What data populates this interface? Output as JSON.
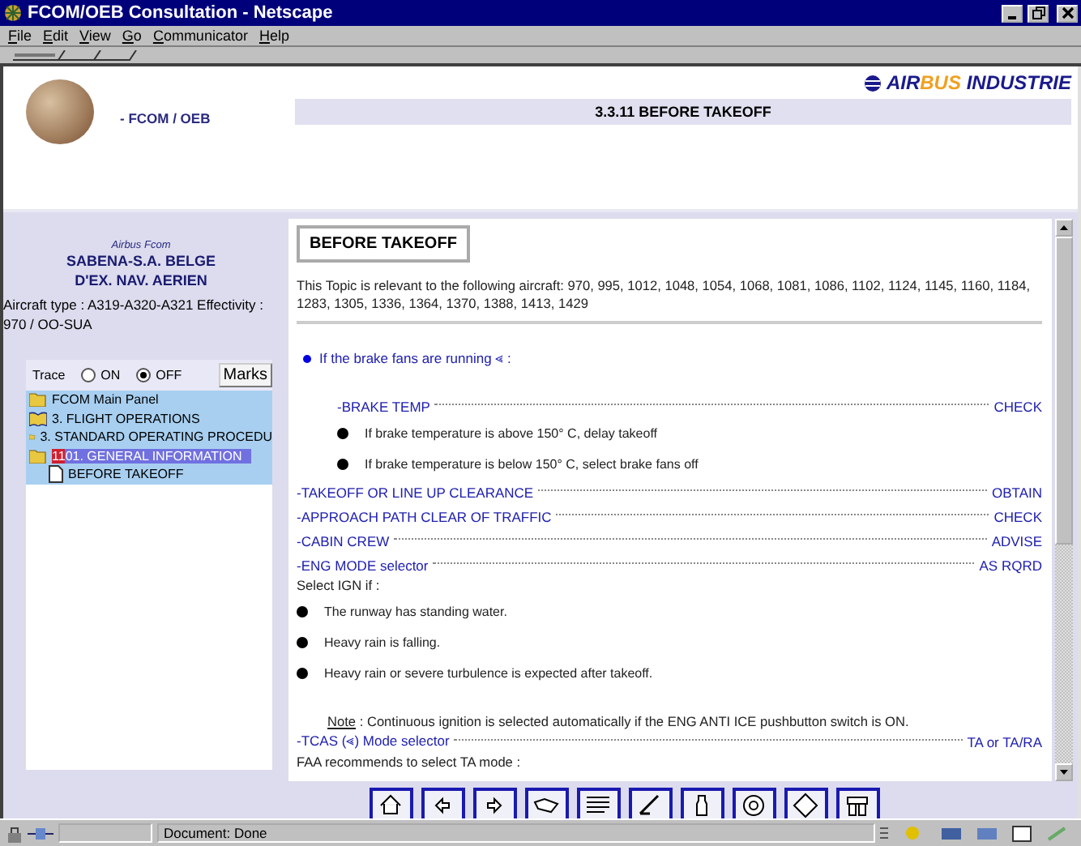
{
  "window": {
    "title": "FCOM/OEB Consultation - Netscape"
  },
  "menu": [
    {
      "label": "File"
    },
    {
      "label": "Edit"
    },
    {
      "label": "View"
    },
    {
      "label": "Go"
    },
    {
      "label": "Communicator"
    },
    {
      "label": "Help"
    }
  ],
  "header": {
    "subtitle": "- FCOM / OEB",
    "brand_parts": [
      {
        "text": "AIR",
        "color": "#1a1a8c"
      },
      {
        "text": "BUS",
        "color": "#f0a020"
      },
      {
        "text": " INDUSTRIE",
        "color": "#1a1a8c"
      }
    ],
    "page_title": "3.3.11 BEFORE TAKEOFF"
  },
  "sidebar": {
    "caption": "Airbus Fcom",
    "operator": [
      "SABENA-S.A. BELGE",
      "D'EX. NAV. AERIEN"
    ],
    "aircraft_info": "Aircraft type : A319-A320-A321 Effectivity : 970 / OO-SUA",
    "trace": {
      "label": "Trace",
      "options": [
        {
          "label": "ON",
          "selected": false
        },
        {
          "label": "OFF",
          "selected": true
        }
      ]
    },
    "marks_button": "Marks",
    "tree": [
      {
        "kind": "folder",
        "label": "FCOM Main Panel",
        "selected": false
      },
      {
        "kind": "book",
        "label": "3. FLIGHT OPERATIONS",
        "selected": false
      },
      {
        "kind": "folder",
        "label": "3. STANDARD OPERATING PROCEDU",
        "selected": false
      },
      {
        "kind": "folder",
        "badge": "11",
        "label": "01. GENERAL INFORMATION",
        "selected": true,
        "children": [
          {
            "kind": "document",
            "label": "BEFORE TAKEOFF",
            "selected": false
          }
        ]
      }
    ]
  },
  "content": {
    "heading": "BEFORE TAKEOFF",
    "relevance": "This Topic is relevant to the following aircraft: 970, 995, 1012, 1048, 1054, 1068, 1081, 1086, 1102, 1124, 1145, 1160, 1184, 1283, 1305, 1336, 1364, 1370, 1388, 1413, 1429",
    "items": [
      {
        "kind": "condition",
        "text": "If the brake fans are running ⪡ :"
      },
      {
        "kind": "check",
        "indented": true,
        "label": "-BRAKE TEMP",
        "action": "CHECK"
      },
      {
        "kind": "bullet",
        "indented": true,
        "text": "If brake temperature is above 150° C, delay takeoff"
      },
      {
        "kind": "bullet",
        "indented": true,
        "text": "If brake temperature is below 150° C, select brake fans off"
      },
      {
        "kind": "check",
        "indented": false,
        "label": "-TAKEOFF OR LINE UP CLEARANCE",
        "action": "OBTAIN"
      },
      {
        "kind": "check",
        "indented": false,
        "label": "-APPROACH PATH CLEAR OF TRAFFIC",
        "action": "CHECK"
      },
      {
        "kind": "check",
        "indented": false,
        "label": "-CABIN CREW",
        "action": "ADVISE"
      },
      {
        "kind": "check",
        "indented": false,
        "label": "-ENG MODE selector",
        "action": "AS RQRD"
      },
      {
        "kind": "plain",
        "text": "Select IGN if :"
      },
      {
        "kind": "bullet",
        "indented": false,
        "text": "The runway has standing water."
      },
      {
        "kind": "bullet",
        "indented": false,
        "text": "Heavy rain is falling."
      },
      {
        "kind": "bullet",
        "indented": false,
        "text": "Heavy rain or severe turbulence is expected after takeoff."
      },
      {
        "kind": "note",
        "label": "Note",
        "text": " : Continuous ignition is selected automatically if the ENG ANTI ICE pushbutton switch is ON."
      },
      {
        "kind": "check",
        "indented": false,
        "label": "-TCAS (⪡) Mode selector",
        "action": "TA or TA/RA"
      },
      {
        "kind": "plain",
        "text": "FAA recommends to select TA mode :"
      }
    ]
  },
  "status_bar": {
    "text": "Document: Done"
  }
}
